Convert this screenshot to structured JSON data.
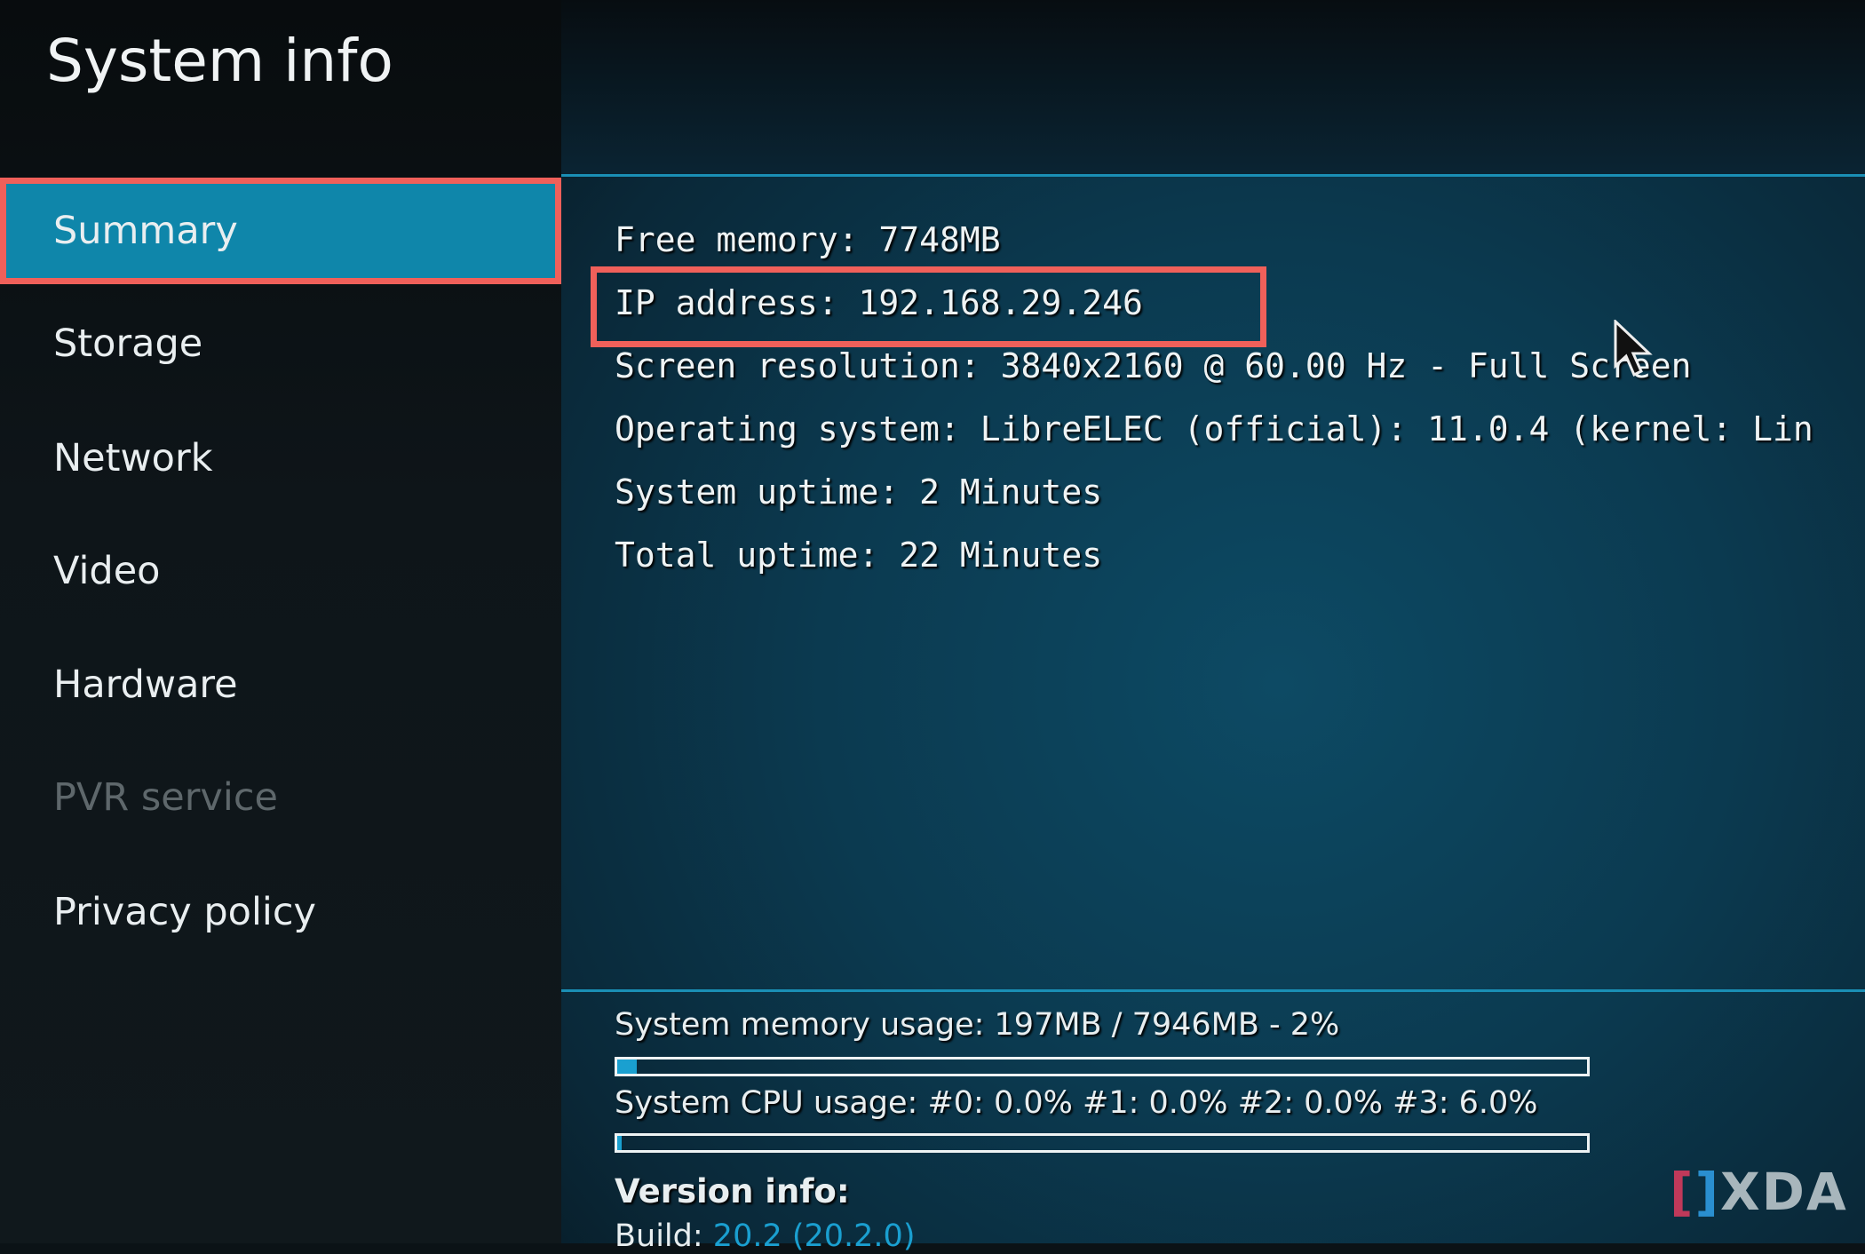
{
  "sidebar": {
    "title": "System info",
    "items": [
      {
        "label": "Summary",
        "state": "selected"
      },
      {
        "label": "Storage",
        "state": "normal"
      },
      {
        "label": "Network",
        "state": "normal"
      },
      {
        "label": "Video",
        "state": "normal"
      },
      {
        "label": "Hardware",
        "state": "normal"
      },
      {
        "label": "PVR service",
        "state": "disabled"
      },
      {
        "label": "Privacy policy",
        "state": "normal"
      }
    ]
  },
  "summary": {
    "lines": [
      "Free memory: 7748MB",
      "IP address: 192.168.29.246",
      "Screen resolution: 3840x2160 @ 60.00 Hz - Full Screen",
      "Operating system: LibreELEC (official): 11.0.4 (kernel: Lin",
      "System uptime: 2 Minutes",
      "Total uptime: 22 Minutes"
    ],
    "highlighted_line": "IP address: 192.168.29.246"
  },
  "usage": {
    "memory_label": "System memory usage: 197MB / 7946MB - 2%",
    "memory_percent": 2,
    "cpu_label": "System CPU usage: #0: 0.0% #1: 0.0% #2: 0.0% #3: 6.0%",
    "cpu_percent": 0.5
  },
  "version": {
    "title": "Version info:",
    "build_label": "Build:",
    "build_value": "20.2 (20.2.0)"
  },
  "watermark": "XDA",
  "colors": {
    "accent": "#0f86aa",
    "highlight_box": "#f0605a",
    "bar_fill": "#1aa0d0"
  }
}
